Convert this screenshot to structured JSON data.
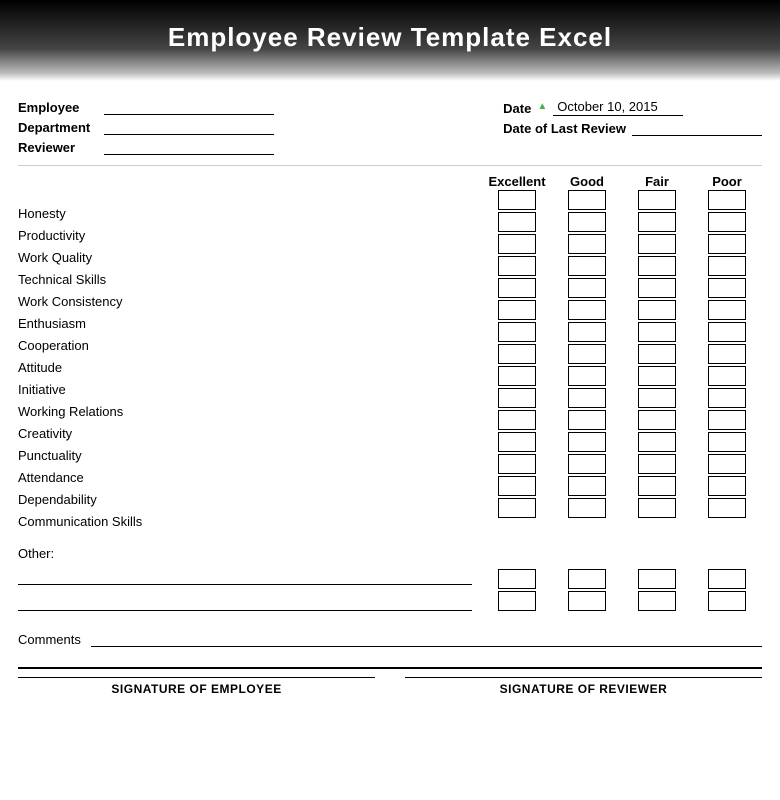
{
  "header": {
    "title": "Employee Review Template Excel"
  },
  "info": {
    "employee_label": "Employee",
    "department_label": "Department",
    "reviewer_label": "Reviewer",
    "date_label": "Date",
    "date_value": "October 10, 2015",
    "last_review_label": "Date of Last Review"
  },
  "rating_columns": [
    {
      "label": "Excellent"
    },
    {
      "label": "Good"
    },
    {
      "label": "Fair"
    },
    {
      "label": "Poor"
    }
  ],
  "skills": [
    "Honesty",
    "Productivity",
    "Work Quality",
    "Technical Skills",
    "Work Consistency",
    "Enthusiasm",
    "Cooperation",
    "Attitude",
    "Initiative",
    "Working Relations",
    "Creativity",
    "Punctuality",
    "Attendance",
    "Dependability",
    "Communication Skills"
  ],
  "other": {
    "label": "Other:"
  },
  "comments": {
    "label": "Comments"
  },
  "signatures": {
    "employee_label": "SIGNATURE OF EMPLOYEE",
    "reviewer_label": "SIGNATURE OF REVIEWER"
  }
}
